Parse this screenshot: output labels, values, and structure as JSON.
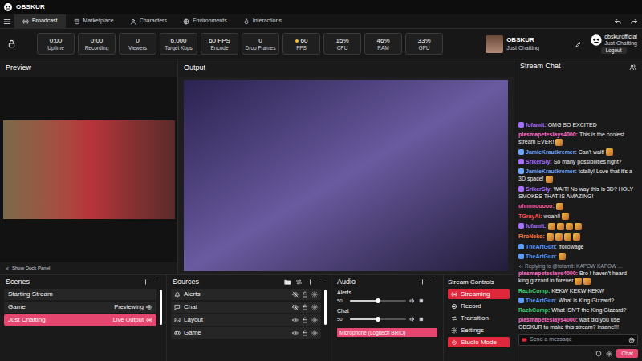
{
  "app": {
    "title": "OBSKUR"
  },
  "tabs": [
    {
      "label": "Broadcast",
      "kind": "broadcast",
      "selected": true
    },
    {
      "label": "Marketplace",
      "kind": "store",
      "selected": false
    },
    {
      "label": "Characters",
      "kind": "user",
      "selected": false
    },
    {
      "label": "Environments",
      "kind": "globe",
      "selected": false
    },
    {
      "label": "Interactions",
      "kind": "flame",
      "selected": false
    }
  ],
  "stats": [
    {
      "value": "0:00",
      "label": "Uptime",
      "dot": false
    },
    {
      "value": "0:00",
      "label": "Recording",
      "dot": false
    },
    {
      "value": "0",
      "label": "Viewers",
      "dot": false
    },
    {
      "value": "6,000",
      "label": "Target Kbps",
      "dot": false
    },
    {
      "value": "60 FPS",
      "label": "Encode",
      "dot": false
    },
    {
      "value": "0",
      "label": "Drop Frames",
      "dot": false
    },
    {
      "value": "60",
      "label": "FPS",
      "dot": true
    },
    {
      "value": "15%",
      "label": "CPU",
      "dot": false
    },
    {
      "value": "46%",
      "label": "RAM",
      "dot": false
    },
    {
      "value": "33%",
      "label": "GPU",
      "dot": false
    }
  ],
  "channel": {
    "name": "OBSKUR",
    "category": "Just Chatting"
  },
  "account": {
    "name": "obskurofficial",
    "category": "Just Chatting",
    "logout": "Logout"
  },
  "preview": {
    "title": "Preview",
    "dock_button": "Show Dock Panel"
  },
  "output": {
    "title": "Output"
  },
  "scenes": {
    "title": "Scenes",
    "items": [
      {
        "label": "Starting Stream",
        "kind": "plain",
        "selected": false
      },
      {
        "label": "Game",
        "status": "Previewing",
        "kind": "preview",
        "selected": false
      },
      {
        "label": "Just Chatting",
        "status": "Live Output",
        "kind": "live",
        "selected": true
      }
    ]
  },
  "sources": {
    "title": "Sources",
    "items": [
      {
        "label": "Alerts",
        "kind": "bell",
        "visible": false,
        "locked": false
      },
      {
        "label": "Chat",
        "kind": "chat",
        "visible": false,
        "locked": false
      },
      {
        "label": "Layout",
        "kind": "image",
        "visible": true,
        "locked": false
      },
      {
        "label": "Game",
        "kind": "game",
        "visible": true,
        "locked": false
      }
    ]
  },
  "audio": {
    "title": "Audio",
    "channels": [
      {
        "name": "Alerts",
        "reading": "50",
        "level": 0.5,
        "muted": false
      },
      {
        "name": "Chat",
        "reading": "50",
        "level": 0.5,
        "muted": false
      }
    ],
    "device": "Microphone (Logitech BRIO)"
  },
  "controls": {
    "title": "Stream Controls",
    "buttons": [
      {
        "label": "Streaming",
        "kind": "live",
        "active": true
      },
      {
        "label": "Record",
        "kind": "record",
        "active": false
      },
      {
        "label": "Transition",
        "kind": "swap",
        "active": false
      },
      {
        "label": "Settings",
        "kind": "gear",
        "active": false
      },
      {
        "label": "Studio Mode",
        "kind": "power",
        "active": true
      }
    ]
  },
  "chat": {
    "title": "Stream Chat",
    "messages": [
      {
        "user": "fofamit:",
        "text": "OMG SO EXCITED",
        "color": "#a970ff",
        "badge": true,
        "emotes": 0
      },
      {
        "user": "plasmapeteslays4000:",
        "text": "This is the coolest stream EVER!",
        "color": "#ff6ec7",
        "badge": false,
        "emotes": 1
      },
      {
        "user": "JamieKrautkremer:",
        "text": "Can't wait!",
        "color": "#6fa8ff",
        "badge": true,
        "emotes": 1
      },
      {
        "user": "SrikerSly:",
        "text": "So many possibilities right?",
        "color": "#a970ff",
        "badge": true,
        "emotes": 0
      },
      {
        "user": "JamieKrautkremer:",
        "text": "totally! Love that it's a 3D space!",
        "color": "#6fa8ff",
        "badge": true,
        "emotes": 1
      },
      {
        "user": "SrikerSly:",
        "text": "WAIT! No way this is 3D? HOLY SMOKES THAT IS AMAZING!",
        "color": "#a970ff",
        "badge": true,
        "emotes": 0
      },
      {
        "user": "ohmmooooo:",
        "color": "#ff5ca8",
        "badge": false,
        "emotes": 1
      },
      {
        "user": "TGrayAi:",
        "text": "woah!!",
        "color": "#ff4d4d",
        "badge": false,
        "emotes": 1
      },
      {
        "user": "fofamit:",
        "color": "#a970ff",
        "badge": true,
        "emotes": 4
      },
      {
        "user": "FiroNeko:",
        "color": "#ff7b3a",
        "badge": false,
        "emotes": 4
      },
      {
        "user": "TheArtGun:",
        "text": "!followage",
        "color": "#5b9bff",
        "badge": true,
        "emotes": 0
      },
      {
        "user": "TheArtGun:",
        "color": "#5b9bff",
        "badge": true,
        "emotes": 1
      },
      {
        "reply": "Replying to @fofamit: KAPOW KAPOW ...",
        "user": "plasmapeteslays4000:",
        "text": "Bro I haven't heard king gizzard in forever",
        "color": "#ff6ec7",
        "badge": false,
        "emotes": 2
      },
      {
        "user": "RachComp:",
        "text": "KEKW KEKW KEKW",
        "color": "#3cd070",
        "badge": false,
        "emotes": 0
      },
      {
        "user": "TheArtGun:",
        "text": "What is King Gizzard?",
        "color": "#5b9bff",
        "badge": true,
        "emotes": 0
      },
      {
        "user": "RachComp:",
        "text": "What ISN'T the King Gizzard?",
        "color": "#3cd070",
        "badge": false,
        "emotes": 0
      },
      {
        "user": "plasmapeteslays4000:",
        "text": "wait did you use OBSKUR to make this stream? insane!!!",
        "color": "#ff6ec7",
        "badge": false,
        "emotes": 0
      }
    ],
    "placeholder": "Send a message",
    "send": "Chat"
  }
}
